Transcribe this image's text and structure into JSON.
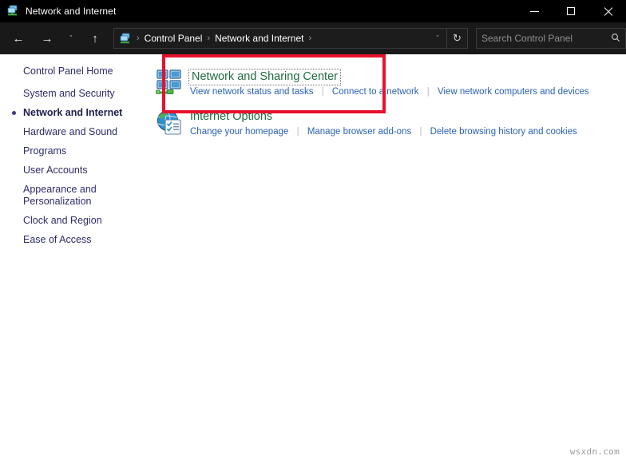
{
  "window": {
    "title": "Network and Internet",
    "icon": "network-window-icon",
    "controls": {
      "minimize": "minimize-button",
      "maximize": "maximize-button",
      "close": "close-button"
    }
  },
  "toolbar": {
    "back": "←",
    "forward": "→",
    "recent": "ˇ",
    "up": "↑",
    "address": {
      "icon": "network-breadcrumb-icon",
      "crumbs": [
        "Control Panel",
        "Network and Internet"
      ],
      "separator": "›",
      "trailing_separator": "›",
      "dropdown": "ˇ",
      "refresh": "↻"
    },
    "search": {
      "placeholder": "Search Control Panel",
      "icon": "🔍"
    }
  },
  "sidebar": {
    "items": [
      {
        "label": "Control Panel Home",
        "current": false,
        "spaced": false
      },
      {
        "label": "System and Security",
        "current": false,
        "spaced": true
      },
      {
        "label": "Network and Internet",
        "current": true,
        "spaced": false
      },
      {
        "label": "Hardware and Sound",
        "current": false,
        "spaced": false
      },
      {
        "label": "Programs",
        "current": false,
        "spaced": false
      },
      {
        "label": "User Accounts",
        "current": false,
        "spaced": false
      },
      {
        "label": "Appearance and",
        "label2": "Personalization",
        "current": false,
        "spaced": false
      },
      {
        "label": "Clock and Region",
        "current": false,
        "spaced": false
      },
      {
        "label": "Ease of Access",
        "current": false,
        "spaced": false
      }
    ]
  },
  "main": {
    "categories": [
      {
        "icon": "network-sharing-center-icon",
        "title": "Network and Sharing Center",
        "focused": true,
        "links": [
          "View network status and tasks",
          "Connect to a network",
          "View network computers and devices"
        ]
      },
      {
        "icon": "internet-options-icon",
        "title": "Internet Options",
        "focused": false,
        "links": [
          "Change your homepage",
          "Manage browser add-ons",
          "Delete browsing history and cookies"
        ]
      }
    ]
  },
  "annotation": {
    "type": "red-highlight-rectangle",
    "color": "#e8112d",
    "targets": "Network and Sharing Center"
  },
  "watermark": {
    "text": "wsxdn.com"
  }
}
